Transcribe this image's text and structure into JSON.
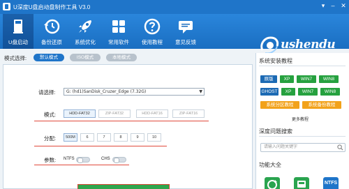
{
  "window": {
    "title": "U深度U盘启动盘制作工具 V3.0",
    "menu_glyph": "▾",
    "minimize_glyph": "–",
    "close_glyph": "✕"
  },
  "toolbar": {
    "items": [
      {
        "label": "U盘启动",
        "icon": "usb-drive-icon"
      },
      {
        "label": "备份还原",
        "icon": "restore-clock-icon"
      },
      {
        "label": "系统优化",
        "icon": "rocket-icon"
      },
      {
        "label": "常用软件",
        "icon": "app-grid-icon"
      },
      {
        "label": "使用教程",
        "icon": "help-circle-icon"
      },
      {
        "label": "意见反馈",
        "icon": "chat-bubble-icon"
      }
    ],
    "active_index": 0,
    "brand": "ushendu"
  },
  "mode": {
    "label": "模式选择:",
    "tabs": [
      "默认模式",
      "ISO模式",
      "本地模式"
    ],
    "active": 0
  },
  "main": {
    "device_label": "请选择:",
    "device_value": "G: (hd1)SanDisk_Cruzer_Edge (7.32G)",
    "device_arrow": "▼",
    "pattern_label": "模式:",
    "patterns": [
      "HDD-FAT32",
      "ZIP-FAT32",
      "HDD-FAT16",
      "ZIP-FAT16"
    ],
    "pattern_selected": 0,
    "alloc_label": "分配:",
    "allocs": [
      "500M",
      "6",
      "7",
      "8",
      "9",
      "10"
    ],
    "alloc_selected": 0,
    "param_label": "参数:",
    "params": [
      {
        "label": "NTFS",
        "on": false
      },
      {
        "label": "CHS",
        "on": false
      }
    ]
  },
  "right": {
    "install_title": "系统安装教程",
    "tags": [
      {
        "text": "原版",
        "color": "blue"
      },
      {
        "text": "XP",
        "color": "green"
      },
      {
        "text": "WIN7",
        "color": "green"
      },
      {
        "text": "WIN8",
        "color": "green"
      },
      {
        "text": "GHOST",
        "color": "blue"
      },
      {
        "text": "XP",
        "color": "green"
      },
      {
        "text": "WIN7",
        "color": "green"
      },
      {
        "text": "WIN8",
        "color": "green"
      },
      {
        "text": "系统分区教程",
        "color": "orange"
      },
      {
        "text": "系统备份教程",
        "color": "orange"
      }
    ],
    "more": "更多教程",
    "search_title": "深度问题搜索",
    "search_placeholder": "请输入问题关键字",
    "func_title": "功能大全",
    "func_items": [
      "",
      "",
      "NTFS"
    ]
  },
  "colors": {
    "titlebar": "#1f75c9",
    "accent_red": "#e04a3c",
    "tag_blue": "#1c6ab4",
    "tag_green": "#26a13f",
    "tag_orange": "#f2a21a",
    "start_green": "#2ea64d"
  }
}
